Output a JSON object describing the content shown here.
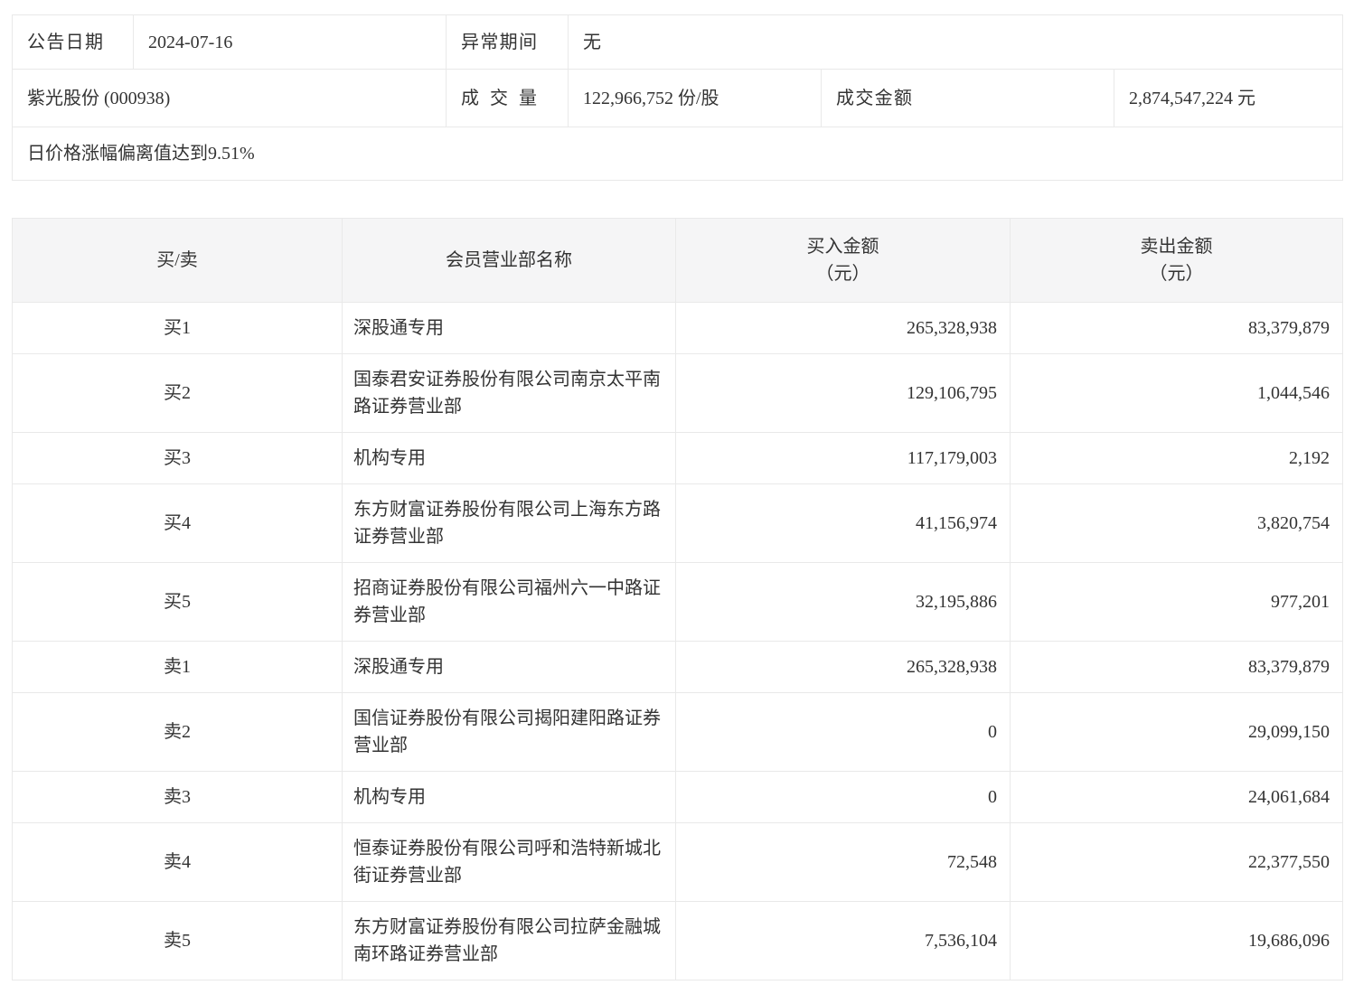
{
  "info": {
    "announce_date_label": "公告日期",
    "announce_date": "2024-07-16",
    "abnormal_period_label": "异常期间",
    "abnormal_period": "无",
    "stock_name": "紫光股份 (000938)",
    "volume_label": "成交量",
    "volume": "122,966,752 份/股",
    "turnover_label": "成交金额",
    "turnover": "2,874,547,224 元",
    "reason": "日价格涨幅偏离值达到9.51%"
  },
  "table": {
    "headers": {
      "side": "买/卖",
      "branch": "会员营业部名称",
      "buy_line1": "买入金额",
      "buy_line2": "（元）",
      "sell_line1": "卖出金额",
      "sell_line2": "（元）"
    },
    "rows": [
      {
        "side": "买1",
        "branch": "深股通专用",
        "buy": "265,328,938",
        "sell": "83,379,879"
      },
      {
        "side": "买2",
        "branch": "国泰君安证券股份有限公司南京太平南路证券营业部",
        "buy": "129,106,795",
        "sell": "1,044,546"
      },
      {
        "side": "买3",
        "branch": "机构专用",
        "buy": "117,179,003",
        "sell": "2,192"
      },
      {
        "side": "买4",
        "branch": "东方财富证券股份有限公司上海东方路证券营业部",
        "buy": "41,156,974",
        "sell": "3,820,754"
      },
      {
        "side": "买5",
        "branch": "招商证券股份有限公司福州六一中路证券营业部",
        "buy": "32,195,886",
        "sell": "977,201"
      },
      {
        "side": "卖1",
        "branch": "深股通专用",
        "buy": "265,328,938",
        "sell": "83,379,879"
      },
      {
        "side": "卖2",
        "branch": "国信证券股份有限公司揭阳建阳路证券营业部",
        "buy": "0",
        "sell": "29,099,150"
      },
      {
        "side": "卖3",
        "branch": "机构专用",
        "buy": "0",
        "sell": "24,061,684"
      },
      {
        "side": "卖4",
        "branch": "恒泰证券股份有限公司呼和浩特新城北街证券营业部",
        "buy": "72,548",
        "sell": "22,377,550"
      },
      {
        "side": "卖5",
        "branch": "东方财富证券股份有限公司拉萨金融城南环路证券营业部",
        "buy": "7,536,104",
        "sell": "19,686,096"
      }
    ],
    "colors": {
      "header_bg": "#f5f5f6",
      "border": "#e9e9e9",
      "text": "#333333"
    }
  }
}
